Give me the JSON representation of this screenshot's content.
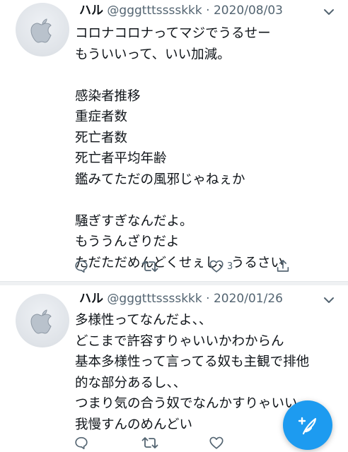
{
  "tweets": [
    {
      "name": "ハル",
      "handle": "@gggtttsssskkk",
      "separator": "·",
      "date": "2020/08/03",
      "text": "コロナコロナってマジでうるせー\nもういいって、いい加減。\n\n感染者推移\n重症者数\n死亡者数\n死亡者平均年齢\n鑑みてただの風邪じゃねぇか\n\n騒ぎすぎなんだよ。\nもううんざりだよ\nただただめんどくせぇし、うるさい",
      "like_count": "3",
      "icons": [
        "reply-icon",
        "retweet-icon",
        "heart-icon",
        "share-icon"
      ]
    },
    {
      "name": "ハル",
      "handle": "@gggtttsssskkk",
      "separator": "·",
      "date": "2020/01/26",
      "text": "多様性ってなんだよ、、\nどこまで許容すりゃいいかわからん\n基本多様性って言ってる奴も主観で排他\n的な部分あるし、、\nつまり気の合う奴でなんかすりゃいい\n我慢すんのめんどい",
      "like_count": "",
      "icons": [
        "reply-icon",
        "retweet-icon",
        "heart-icon",
        "share-icon"
      ]
    }
  ],
  "compose_button": {
    "icon": "compose-feather-icon",
    "color": "#1d9bf0"
  },
  "colors": {
    "accent": "#1d9bf0",
    "muted": "#536471",
    "text": "#0f1419"
  }
}
